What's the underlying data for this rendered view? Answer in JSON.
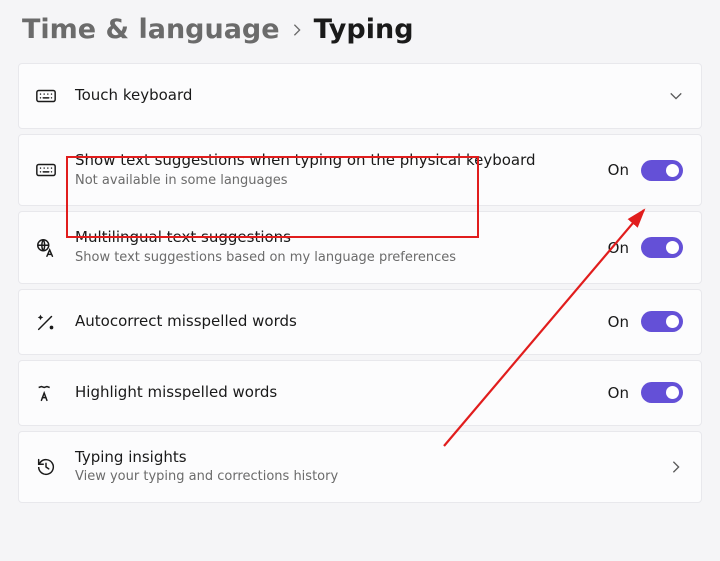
{
  "breadcrumb": {
    "parent": "Time & language",
    "current": "Typing"
  },
  "rows": {
    "touch_keyboard": {
      "title": "Touch keyboard"
    },
    "show_text_suggestions": {
      "title": "Show text suggestions when typing on the physical keyboard",
      "subtitle": "Not available in some languages",
      "state_label": "On"
    },
    "multilingual": {
      "title": "Multilingual text suggestions",
      "subtitle": "Show text suggestions based on my language preferences",
      "state_label": "On"
    },
    "autocorrect": {
      "title": "Autocorrect misspelled words",
      "state_label": "On"
    },
    "highlight": {
      "title": "Highlight misspelled words",
      "state_label": "On"
    },
    "insights": {
      "title": "Typing insights",
      "subtitle": "View your typing and corrections history"
    }
  },
  "colors": {
    "accent": "#6450d7",
    "annotation": "#e11d1d"
  }
}
